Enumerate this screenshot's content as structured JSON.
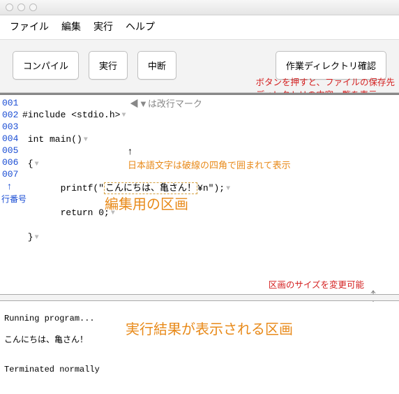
{
  "menubar": {
    "file": "ファイル",
    "edit": "編集",
    "run": "実行",
    "help": "ヘルプ"
  },
  "toolbar": {
    "compile": "コンパイル",
    "run": "実行",
    "stop": "中断",
    "wd": "作業ディレクトリ確認"
  },
  "annotations": {
    "button_note": "ボタンを押すと、ファイルの保存先\nディレクトリの内容一覧を表示",
    "nl_mark_note": "▼は改行マーク",
    "jp_note": "日本語文字は破線の四角で囲まれて表示",
    "line_no_note": "行番号",
    "editor_pane": "編集用の区画",
    "resize_note": "区画のサイズを変更可能",
    "output_pane": "実行結果が表示される区画"
  },
  "gutter": [
    "001",
    "002",
    "003",
    "004",
    "005",
    "006",
    "007"
  ],
  "code": {
    "l1a": "#include <stdio.h>",
    "l2a": " int main()",
    "l3a": " {",
    "l4a": "       printf(\"",
    "l4jp": "こんにちは、亀さん！",
    "l4b": "¥n\");",
    "l5a": "       return 0;",
    "l6a": " }",
    "l7a": ""
  },
  "output": {
    "line1": "Running program...",
    "line2": "こんにちは、亀さん！",
    "line3": "",
    "line4": "Terminated normally"
  }
}
